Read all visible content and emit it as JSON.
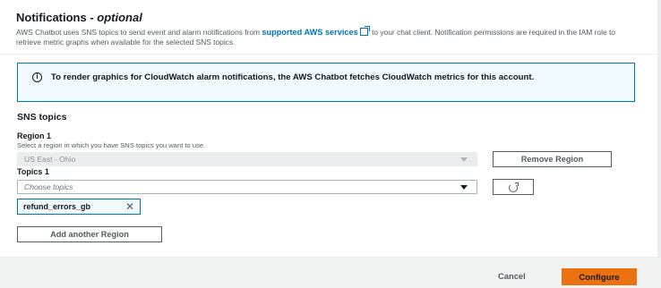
{
  "notifications": {
    "title": "Notifications - ",
    "title_optional": "optional",
    "desc_before": "AWS Chatbot uses SNS topics to send event and alarm notifications from ",
    "desc_link": "supported AWS services",
    "desc_after": " to your chat client. Notification permissions are required in the IAM role to retrieve metric graphs when available for the selected SNS topics."
  },
  "info": {
    "text": "To render graphics for CloudWatch alarm notifications, the AWS Chatbot fetches CloudWatch metrics for this account."
  },
  "sns": {
    "section_title": "SNS topics",
    "region_label": "Region 1",
    "region_hint": "Select a region in which you have SNS topics you want to use.",
    "region_value": "US East - Ohio",
    "remove_region": "Remove Region",
    "topics_label": "Topics 1",
    "topics_placeholder": "Choose topics",
    "selected_topic": "refund_errors_gb",
    "token_remove": "✕",
    "add_region": "Add another Region"
  },
  "footer": {
    "cancel": "Cancel",
    "configure": "Configure"
  },
  "colors": {
    "link": "#0073bb",
    "primary": "#ec7211",
    "info_bg": "#f1faff"
  }
}
